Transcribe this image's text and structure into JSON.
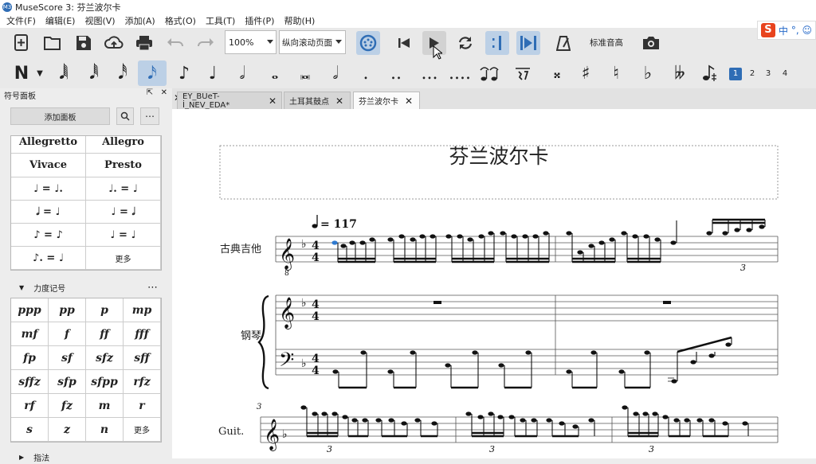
{
  "window": {
    "title": "MuseScore 3: 芬兰波尔卡",
    "app_badge": "M3"
  },
  "menu": [
    "文件(F)",
    "编辑(E)",
    "视图(V)",
    "添加(A)",
    "格式(O)",
    "工具(T)",
    "插件(P)",
    "帮助(H)"
  ],
  "ime": {
    "logo": "S",
    "lang": "中",
    "punct": "°,",
    "emoji": "☺"
  },
  "toolbar": {
    "zoom": "100%",
    "view_mode": "纵向滚动页面",
    "concert_pitch": "标准音高"
  },
  "note_input": {
    "mode_glyph": "N",
    "durations": [
      "𝅘𝅥𝅲",
      "𝅘𝅥𝅱",
      "𝅘𝅥𝅰",
      "𝅘𝅥𝅯",
      "♪",
      "♩",
      "𝅗𝅥",
      "𝅝",
      "𝅜",
      "𝅗𝅥"
    ],
    "dots": [
      ".",
      "..",
      "...",
      "...."
    ],
    "accidentals": [
      "𝄪",
      "♯",
      "♮",
      "♭",
      "𝄫"
    ],
    "voices": [
      "1",
      "2",
      "3",
      "4"
    ]
  },
  "palette": {
    "header": "符号面板",
    "add_button": "添加面板",
    "tempo_cells": [
      "Allegretto",
      "Allegro",
      "Vivace",
      "Presto",
      "♩ = ♩.",
      "♩. = ♩",
      "𝅗𝅥 = ♩",
      "♩ = 𝅗𝅥",
      "♪ = ♪",
      "♩ = ♩",
      "♪. = ♩",
      "更多"
    ],
    "dynamics_title": "力度记号",
    "dynamics": [
      "ppp",
      "pp",
      "p",
      "mp",
      "mf",
      "f",
      "ff",
      "fff",
      "fp",
      "sf",
      "sfz",
      "sff",
      "sffz",
      "sfp",
      "sfpp",
      "rfz",
      "rf",
      "fz",
      "m",
      "r",
      "s",
      "z",
      "n",
      "更多"
    ],
    "fingering_title": "指法"
  },
  "tabs": [
    {
      "label": "EY_BUeT-İ_NEV_EDA*",
      "active": false
    },
    {
      "label": "土耳其鼓点",
      "active": false
    },
    {
      "label": "芬兰波尔卡",
      "active": true
    }
  ],
  "score": {
    "title": "芬兰波尔卡",
    "tempo": "= 117",
    "time_sig": "4",
    "instruments": [
      "古典吉他",
      "钢琴",
      "Guit."
    ],
    "tuplet": "3",
    "measure_number": "3",
    "colors": {
      "selected_note": "#2f7ad0"
    }
  }
}
